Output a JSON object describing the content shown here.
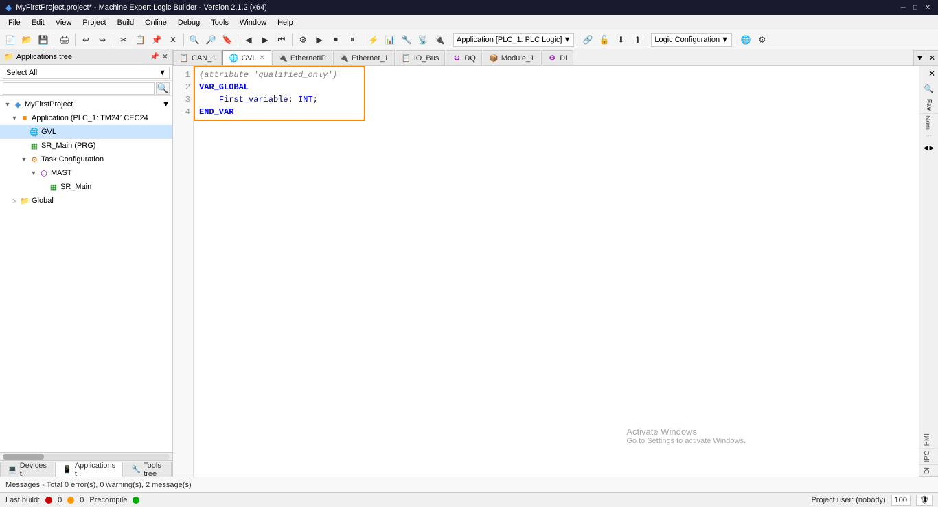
{
  "titlebar": {
    "title": "MyFirstProject.project* - Machine Expert Logic Builder - Version 2.1.2 (x64)",
    "icon": "◆",
    "min_btn": "─",
    "max_btn": "□",
    "close_btn": "✕"
  },
  "menubar": {
    "items": [
      "File",
      "Edit",
      "View",
      "Project",
      "Build",
      "Online",
      "Debug",
      "Tools",
      "Window",
      "Help"
    ]
  },
  "toolbar": {
    "app_selector_label": "Application [PLC_1: PLC Logic]",
    "logic_config_label": "Logic Configuration"
  },
  "left_panel": {
    "title": "Applications tree",
    "select_all_label": "Select All",
    "search_placeholder": "",
    "tree": {
      "project_label": "MyFirstProject",
      "app_label": "Application (PLC_1: TM241CEC24",
      "gvl_label": "GVL",
      "sr_main_label": "SR_Main (PRG)",
      "task_config_label": "Task Configuration",
      "mast_label": "MAST",
      "sr_main2_label": "SR_Main",
      "global_label": "Global"
    }
  },
  "tabs": [
    {
      "id": "can1",
      "label": "CAN_1",
      "icon": "📋",
      "closable": false,
      "active": false
    },
    {
      "id": "gvl",
      "label": "GVL",
      "icon": "📄",
      "closable": true,
      "active": true
    },
    {
      "id": "ethernetip",
      "label": "EthernetIP",
      "icon": "🔌",
      "closable": false,
      "active": false
    },
    {
      "id": "ethernet1",
      "label": "Ethernet_1",
      "icon": "🔌",
      "closable": false,
      "active": false
    },
    {
      "id": "iobus",
      "label": "IO_Bus",
      "icon": "📋",
      "closable": false,
      "active": false
    },
    {
      "id": "dq",
      "label": "DQ",
      "icon": "⚙",
      "closable": false,
      "active": false
    },
    {
      "id": "module1",
      "label": "Module_1",
      "icon": "📦",
      "closable": false,
      "active": false
    },
    {
      "id": "di",
      "label": "DI",
      "icon": "⚙",
      "closable": false,
      "active": false
    }
  ],
  "code": {
    "lines": [
      {
        "num": "1",
        "content_raw": "{attribute 'qualified_only'}",
        "parts": [
          {
            "text": "{attribute 'qualified_only'}",
            "class": "kw-attribute"
          }
        ]
      },
      {
        "num": "2",
        "content_raw": "VAR_GLOBAL",
        "parts": [
          {
            "text": "VAR_GLOBAL",
            "class": "kw-var"
          }
        ]
      },
      {
        "num": "3",
        "content_raw": "    First_variable: INT;",
        "parts": [
          {
            "text": "    "
          },
          {
            "text": "First_variable",
            "class": "var-name"
          },
          {
            "text": ": "
          },
          {
            "text": "INT",
            "class": "kw-type"
          },
          {
            "text": ";"
          }
        ]
      },
      {
        "num": "4",
        "content_raw": "END_VAR",
        "parts": [
          {
            "text": "END_VAR",
            "class": "kw-end"
          }
        ]
      }
    ]
  },
  "right_sidebar": {
    "fav_label": "Fav",
    "nam_label": "Nam",
    "hmi_label": "HMI",
    "ipc_label": "IPC",
    "di_label": "DI"
  },
  "bottom_tabs": [
    {
      "label": "Devices t...",
      "icon": "💻",
      "active": false
    },
    {
      "label": "Applications t...",
      "icon": "📱",
      "active": true
    },
    {
      "label": "Tools tree",
      "icon": "🔧",
      "active": false
    }
  ],
  "messages": {
    "text": "Messages - Total 0 error(s), 0 warning(s), 2 message(s)"
  },
  "statusbar": {
    "last_build_label": "Last build:",
    "errors": "0",
    "warnings": "0",
    "precompile_label": "Precompile",
    "project_user_label": "Project user: (nobody)",
    "zoom": "100"
  },
  "activate_windows": {
    "line1": "Activate Windows",
    "line2": "Go to Settings to activate Windows."
  }
}
